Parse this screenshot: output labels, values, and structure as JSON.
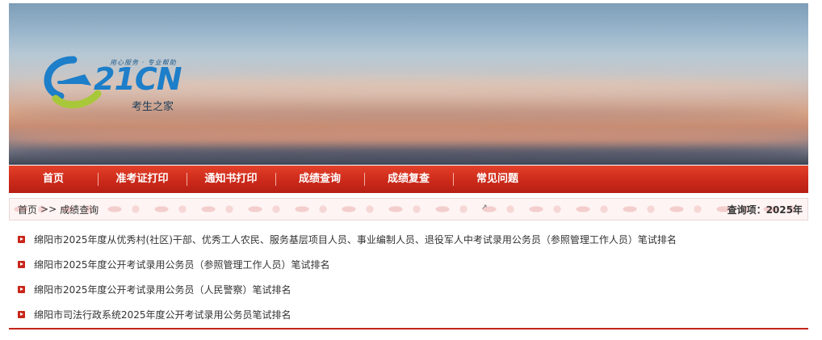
{
  "header": {
    "logo": {
      "brand": "21CN",
      "slogan": "用心服务 · 专业帮助",
      "subtitle": "考生之家"
    }
  },
  "nav": {
    "items": [
      {
        "label": "首页"
      },
      {
        "label": "准考证打印"
      },
      {
        "label": "通知书打印"
      },
      {
        "label": "成绩查询"
      },
      {
        "label": "成绩复查"
      },
      {
        "label": "常见问题"
      }
    ]
  },
  "breadcrumb": {
    "home": "首页",
    "separator": ">>",
    "current": "成绩查询",
    "query_label": "查询项：2025年"
  },
  "list": {
    "items": [
      {
        "text": "绵阳市2025年度从优秀村(社区)干部、优秀工人农民、服务基层项目人员、事业编制人员、退役军人中考试录用公务员（参照管理工作人员）笔试排名"
      },
      {
        "text": "绵阳市2025年度公开考试录用公务员（参照管理工作人员）笔试排名"
      },
      {
        "text": "绵阳市2025年度公开考试录用公务员（人民警察）笔试排名"
      },
      {
        "text": "绵阳市司法行政系统2025年度公开考试录用公务员笔试排名"
      }
    ]
  },
  "colors": {
    "nav_red": "#cc2a1a",
    "bullet_red": "#c8261a",
    "logo_blue": "#1d7ec9",
    "logo_green": "#a8c83a"
  }
}
